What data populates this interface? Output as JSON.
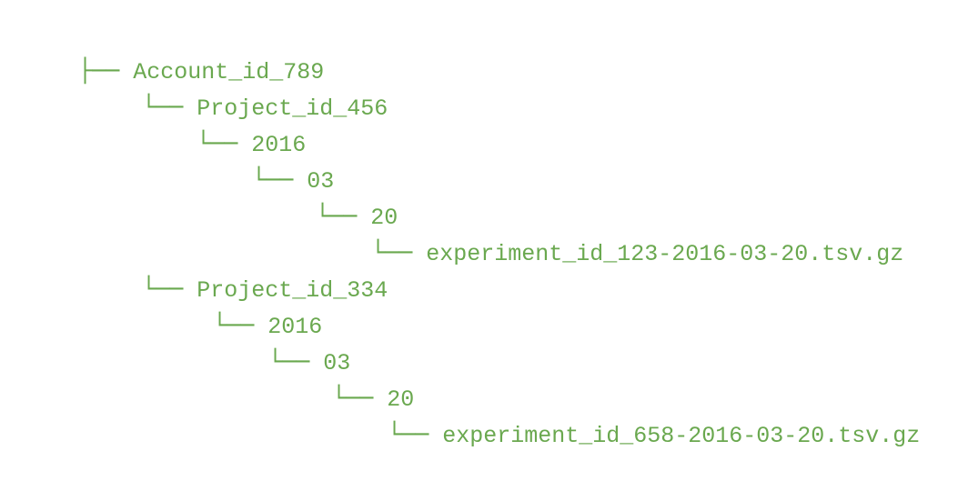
{
  "colors": {
    "text": "#6aa84f",
    "background": "#ffffff"
  },
  "tree": [
    {
      "branch": "├──",
      "label": "Account_id_789"
    },
    {
      "branch": "└──",
      "label": "Project_id_456"
    },
    {
      "branch": "└──",
      "label": "2016"
    },
    {
      "branch": "└──",
      "label": "03"
    },
    {
      "branch": "└──",
      "label": "20"
    },
    {
      "branch": "└──",
      "label": "experiment_id_123-2016-03-20.tsv.gz"
    },
    {
      "branch": "└──",
      "label": "Project_id_334"
    },
    {
      "branch": "└──",
      "label": "2016"
    },
    {
      "branch": "└──",
      "label": "03"
    },
    {
      "branch": "└──",
      "label": "20"
    },
    {
      "branch": "└──",
      "label": "experiment_id_658-2016-03-20.tsv.gz"
    }
  ]
}
